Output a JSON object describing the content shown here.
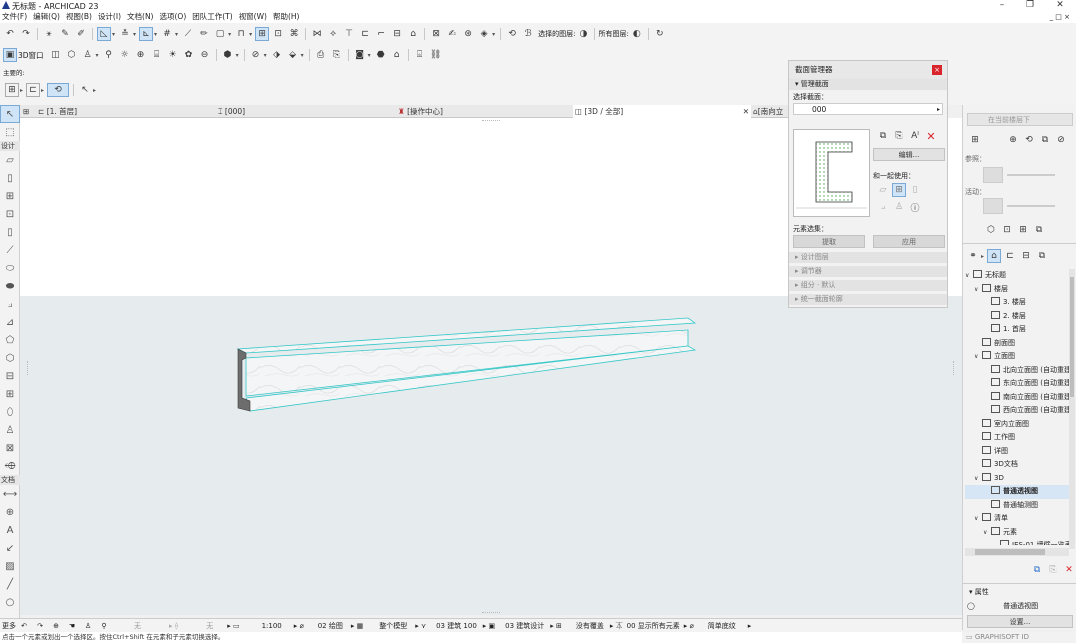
{
  "window": {
    "title": "无标题 - ARCHICAD 23",
    "minimize": "–",
    "maximize": "❐",
    "close": "✕",
    "inner_minimize": "_ □ ×"
  },
  "menu": [
    "文件(F)",
    "编辑(Q)",
    "视图(B)",
    "设计(I)",
    "文档(N)",
    "选项(O)",
    "团队工作(T)",
    "视窗(W)",
    "帮助(H)"
  ],
  "toolbar1": {
    "layer_label": "选择的图层:",
    "all_layers_label": "所有图层:"
  },
  "toolbar2": {
    "window3d_label": "3D窗口"
  },
  "toolbar3": {
    "main_label": "主要的:"
  },
  "tabs": [
    {
      "label": "[1. 首层]"
    },
    {
      "label": "[000]"
    },
    {
      "label": "[操作中心]"
    },
    {
      "label": "[3D / 全部]"
    },
    {
      "label": "[南向立"
    }
  ],
  "toolbox": {
    "design_header": "设计",
    "document_header": "文档",
    "more_label": "更多"
  },
  "section_manager": {
    "title": "截面管理器",
    "manage_header": "管理截面",
    "select_label": "选择截面：",
    "selected_value": "000",
    "edit_button": "编辑...",
    "use_with_label": "和一起使用：",
    "element_selection_label": "元素选集：",
    "extract_button": "提取",
    "apply_button": "应用",
    "sections": [
      "设计图层",
      "调节器",
      "组分 · 默认",
      "统一截面轮廓"
    ]
  },
  "right_top": {
    "floor_placeholder": "在当前楼层下",
    "ref_label": "参照：",
    "active_label": "活动："
  },
  "navigator": {
    "items": [
      {
        "label": "无标题",
        "level": 0,
        "exp": "∨"
      },
      {
        "label": "楼层",
        "level": 1,
        "exp": "∨"
      },
      {
        "label": "3. 楼层",
        "level": 2,
        "exp": ""
      },
      {
        "label": "2. 楼层",
        "level": 2,
        "exp": ""
      },
      {
        "label": "1. 首层",
        "level": 2,
        "exp": ""
      },
      {
        "label": "剖面图",
        "level": 1,
        "exp": ""
      },
      {
        "label": "立面图",
        "level": 1,
        "exp": "∨"
      },
      {
        "label": "北向立面图 (自动重建",
        "level": 2,
        "exp": ""
      },
      {
        "label": "东向立面图 (自动重建",
        "level": 2,
        "exp": ""
      },
      {
        "label": "南向立面图 (自动重建",
        "level": 2,
        "exp": ""
      },
      {
        "label": "西向立面图 (自动重建",
        "level": 2,
        "exp": ""
      },
      {
        "label": "室内立面图",
        "level": 1,
        "exp": ""
      },
      {
        "label": "工作图",
        "level": 1,
        "exp": ""
      },
      {
        "label": "详图",
        "level": 1,
        "exp": ""
      },
      {
        "label": "3D文档",
        "level": 1,
        "exp": ""
      },
      {
        "label": "3D",
        "level": 1,
        "exp": "∨"
      },
      {
        "label": "普通透视图",
        "level": 2,
        "exp": ""
      },
      {
        "label": "普通轴测图",
        "level": 2,
        "exp": ""
      },
      {
        "label": "清单",
        "level": 1,
        "exp": "∨"
      },
      {
        "label": "元素",
        "level": 2,
        "exp": "∨"
      },
      {
        "label": "IES-01 墙壁一览表",
        "level": 3,
        "exp": ""
      }
    ],
    "selected_index": 16
  },
  "properties": {
    "header": "属性",
    "value": "普通透视图",
    "settings_button": "设置..."
  },
  "brand": "GRAPHISOFT ID",
  "statusbar": {
    "none1": "无",
    "none2": "无",
    "scale": "1:100",
    "drawing": "02 绘图",
    "model": "整个模型",
    "building": "03 建筑 100",
    "design": "03 建筑设计",
    "cover": "没有覆盖",
    "show": "00 显示所有元素",
    "simple": "简单底纹"
  },
  "hint": "点击一个元素或划出一个选择区。按住Ctrl+Shift 在元素和子元素切换选择。",
  "colors": {
    "accent": "#1f6fc5",
    "selection": "#cfe4f7",
    "close_red": "#d9242b",
    "model_outline": "#34c7c7"
  }
}
